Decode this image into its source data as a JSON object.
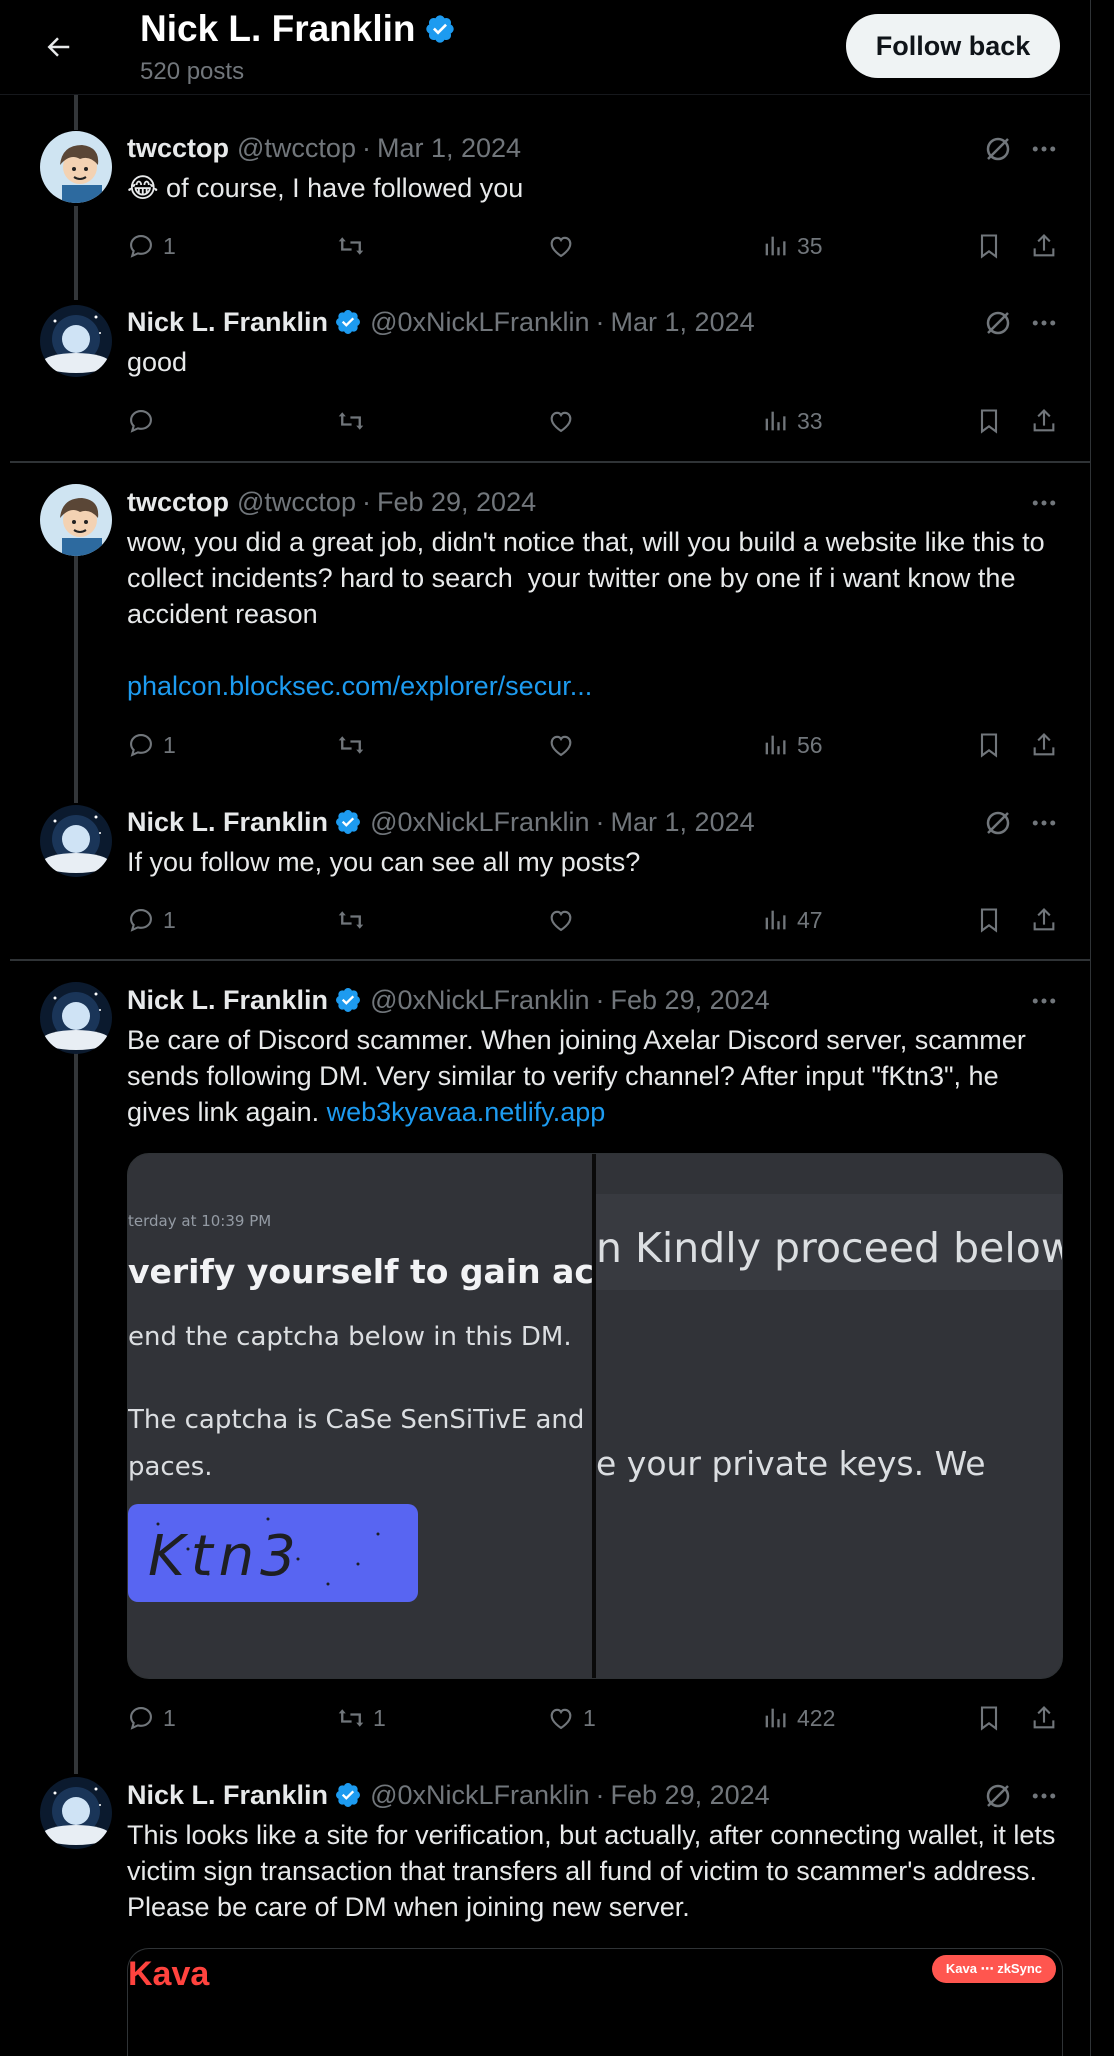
{
  "header": {
    "name": "Nick L. Franklin",
    "post_count": "520 posts",
    "follow_button": "Follow back"
  },
  "colors": {
    "accent": "#1d9bf0",
    "background": "#000000",
    "muted": "#71767b",
    "verified": "#1d9bf0"
  },
  "posts": [
    {
      "name": "twcctop",
      "handle": "@twcctop",
      "date": "Mar 1, 2024",
      "text": "😂 of course, I have followed you",
      "link": "",
      "replies": "1",
      "reposts": "",
      "likes": "",
      "views": "35"
    },
    {
      "name": "Nick L. Franklin",
      "handle": "@0xNickLFranklin",
      "date": "Mar 1, 2024",
      "text": "good",
      "link": "",
      "replies": "",
      "reposts": "",
      "likes": "",
      "views": "33"
    },
    {
      "name": "twcctop",
      "handle": "@twcctop",
      "date": "Feb 29, 2024",
      "text": "wow, you did a great job, didn't notice that, will you build a website like this to collect incidents? hard to search  your twitter one by one if i want know the accident reason",
      "link": "phalcon.blocksec.com/explorer/secur...",
      "replies": "1",
      "reposts": "",
      "likes": "",
      "views": "56"
    },
    {
      "name": "Nick L. Franklin",
      "handle": "@0xNickLFranklin",
      "date": "Mar 1, 2024",
      "text": "If you follow me, you can see all my posts?",
      "link": "",
      "replies": "1",
      "reposts": "",
      "likes": "",
      "views": "47"
    },
    {
      "name": "Nick L. Franklin",
      "handle": "@0xNickLFranklin",
      "date": "Feb 29, 2024",
      "text": "Be care of Discord scammer. When joining Axelar Discord server, scammer sends following DM. Very similar to verify channel? After input \"fKtn3\", he gives link again. ",
      "link": "web3kyavaa.netlify.app",
      "replies": "1",
      "reposts": "1",
      "likes": "1",
      "views": "422",
      "media": {
        "timestamp": "terday at 10:39 PM",
        "heading": "verify yourself to gain access",
        "line1": "end the captcha below in this DM.",
        "line2": "The captcha is CaSe SenSiTivE and",
        "line3": "paces.",
        "captcha": "Ktn3",
        "right_heading": "n Kindly proceed below",
        "right_line": "e your private keys. We"
      }
    },
    {
      "name": "Nick L. Franklin",
      "handle": "@0xNickLFranklin",
      "date": "Feb 29, 2024",
      "text": "This looks like a site for verification, but actually, after connecting wallet, it lets victim sign transaction that transfers all fund of victim to scammer's address. Please be care of DM when joining new server.",
      "link": "",
      "media": {
        "logo": "Kava",
        "badge": "Kava ⋯ zkSync"
      }
    }
  ]
}
